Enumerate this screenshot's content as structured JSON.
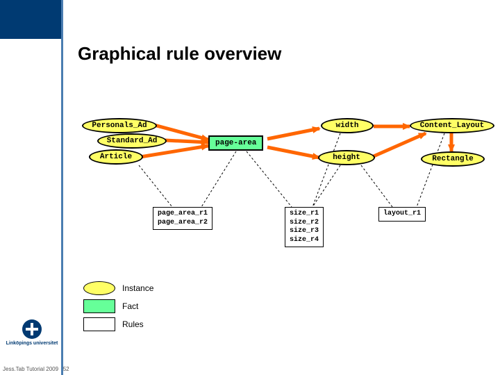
{
  "title": "Graphical rule overview",
  "nodes": {
    "personals_ad": "Personals_Ad",
    "standard_ad": "Standard_Ad",
    "article": "Article",
    "width": "width",
    "height": "height",
    "content_layout": "Content_Layout",
    "rectangle": "Rectangle",
    "page_area": "page-area"
  },
  "rules": {
    "page_area": [
      "page_area_r1",
      "page_area_r2"
    ],
    "size": [
      "size_r1",
      "size_r2",
      "size_r3",
      "size_r4"
    ],
    "layout": [
      "layout_r1"
    ]
  },
  "legend": {
    "instance": "Instance",
    "fact": "Fact",
    "rules": "Rules"
  },
  "footer": {
    "university": "Linköpings universitet",
    "note": "Jess.Tab Tutorial 2009",
    "page": "52"
  }
}
